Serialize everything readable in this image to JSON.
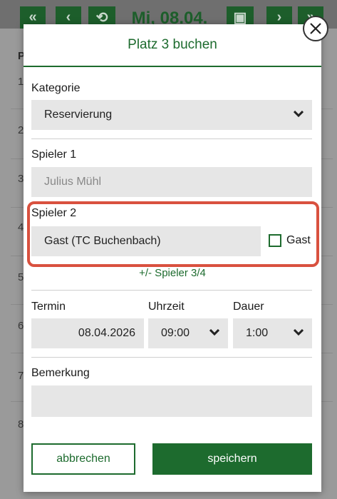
{
  "background": {
    "date_label": "Mi, 08.04.",
    "column_header": "P",
    "row_numbers": [
      "1",
      "2",
      "3",
      "4",
      "5",
      "6",
      "7",
      "8"
    ]
  },
  "modal": {
    "title": "Platz 3 buchen",
    "kategorie": {
      "label": "Kategorie",
      "value": "Reservierung"
    },
    "spieler1": {
      "label": "Spieler 1",
      "value": "Julius Mühl"
    },
    "spieler2": {
      "label": "Spieler 2",
      "value": "Gast (TC Buchenbach)",
      "gast_label": "Gast",
      "gast_checked": false
    },
    "players_link": "+/- Spieler 3/4",
    "termin": {
      "label": "Termin",
      "value": "08.04.2026"
    },
    "uhrzeit": {
      "label": "Uhrzeit",
      "value": "09:00"
    },
    "dauer": {
      "label": "Dauer",
      "value": "1:00"
    },
    "bemerkung": {
      "label": "Bemerkung",
      "value": ""
    },
    "cancel_label": "abbrechen",
    "save_label": "speichern"
  },
  "colors": {
    "accent": "#1d6b2e",
    "highlight": "#d9513f",
    "field": "#e6e6e6"
  }
}
